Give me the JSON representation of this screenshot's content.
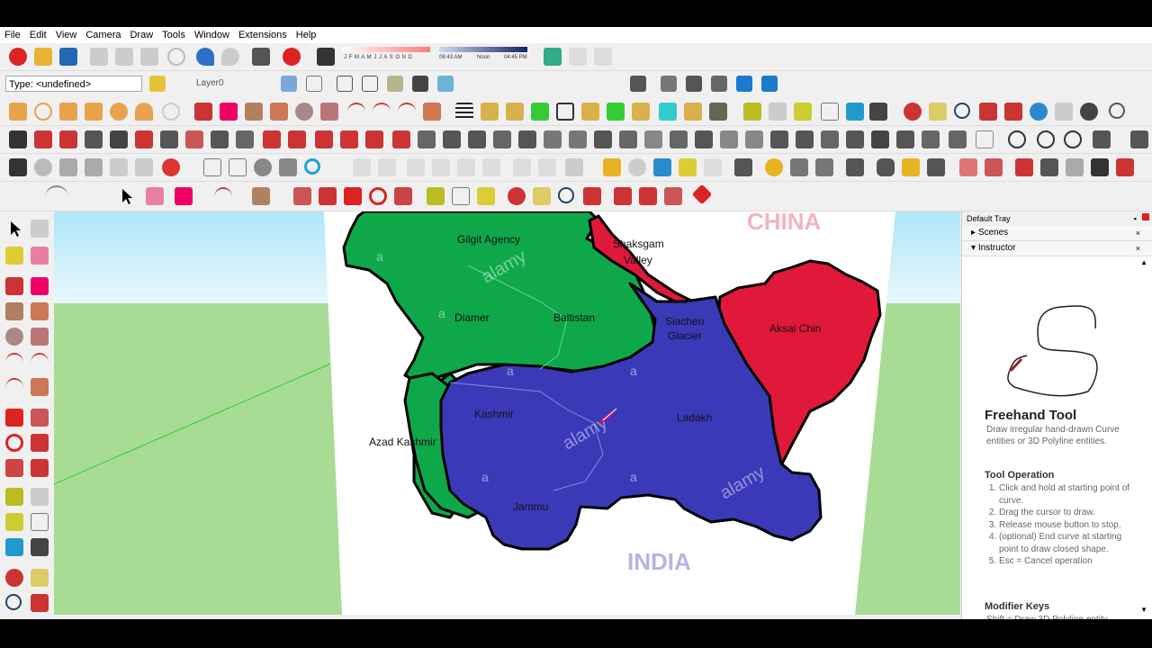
{
  "menu": [
    "File",
    "Edit",
    "View",
    "Camera",
    "Draw",
    "Tools",
    "Window",
    "Extensions",
    "Help"
  ],
  "toolbar": {
    "type_label": "Type: <undefined>",
    "layer_label": "Layer0",
    "shadow_months": "J F M A M J J A S O N D",
    "time_start": "06:43 AM",
    "time_noon": "Noon",
    "time_end": "04:45 PM"
  },
  "map": {
    "country_top": "CHINA",
    "country_bottom": "INDIA",
    "regions": [
      "Gilgit Agency",
      "Shaksgam",
      "Valley",
      "Diamer",
      "Baltistan",
      "Siachen",
      "Glacier",
      "Aksai Chin",
      "Kashmir",
      "Ladakh",
      "Azad Kashmir",
      "Jammu"
    ],
    "watermark": "alamy",
    "wm_letter": "a"
  },
  "tray": {
    "title": "Default Tray",
    "panels": [
      "Scenes",
      "Instructor"
    ],
    "tool_name": "Freehand Tool",
    "tool_desc": "Draw irregular hand-drawn Curve entities or 3D Polyline entities.",
    "operation_title": "Tool Operation",
    "operation_steps": [
      "Click and hold at starting point of curve.",
      "Drag the cursor to draw.",
      "Release mouse button to stop.",
      "(optional) End curve at starting point to draw closed shape.",
      "Esc = Cancel operation"
    ],
    "modifier_title": "Modifier Keys",
    "modifier_text": "Shift = Draw 3D Polyline entity"
  },
  "colors": {
    "green": "#0ea84a",
    "red": "#e0193a",
    "blue": "#3a3ab8",
    "sky": "#d6f1fa",
    "ground": "#a8dc95"
  }
}
